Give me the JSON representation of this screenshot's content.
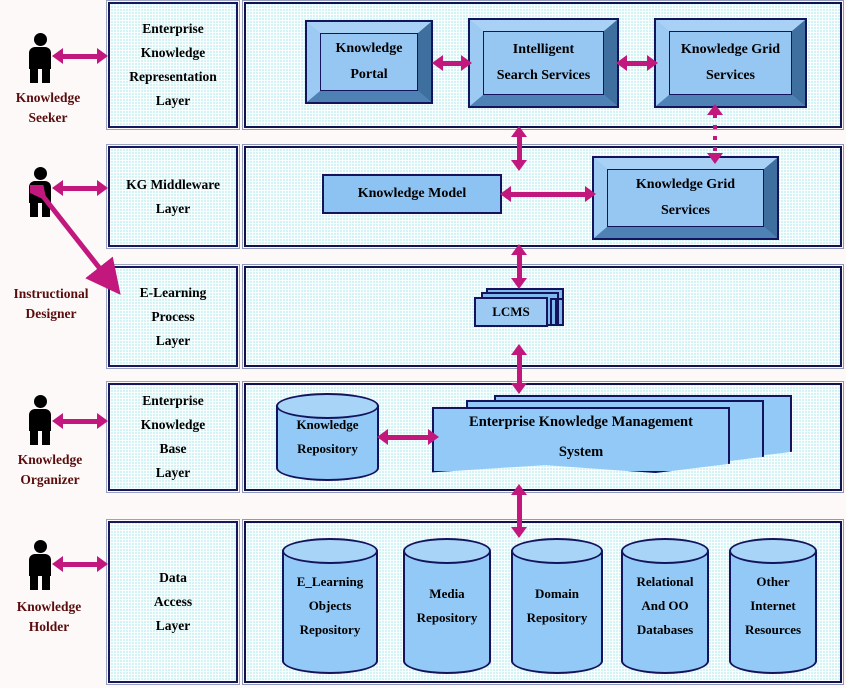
{
  "diagram": {
    "title": "Enterprise Knowledge Management Layered Architecture",
    "colors": {
      "arrow": "#c2187e",
      "box_border": "#14145c",
      "box_fill": "#93c9f6",
      "panel_fill": "#d3f3f5",
      "actor": "#000000",
      "actor_label": "#5a0d0d"
    }
  },
  "actors": [
    {
      "id": "knowledge-seeker",
      "label_line1": "Knowledge",
      "label_line2": "Seeker"
    },
    {
      "id": "instructional-designer",
      "label_line1": "Instructional",
      "label_line2": "Designer"
    },
    {
      "id": "knowledge-organizer",
      "label_line1": "Knowledge",
      "label_line2": "Organizer"
    },
    {
      "id": "knowledge-holder",
      "label_line1": "Knowledge",
      "label_line2": "Holder"
    }
  ],
  "layers": [
    {
      "id": "enterprise-knowledge-representation-layer",
      "label": "Enterprise\nKnowledge\nRepresentation\nLayer",
      "nodes": [
        {
          "id": "knowledge-portal",
          "label": "Knowledge\nPortal",
          "shape": "bevel-box"
        },
        {
          "id": "intelligent-search-services",
          "label": "Intelligent\nSearch Services",
          "shape": "bevel-box"
        },
        {
          "id": "knowledge-grid-services-top",
          "label": "Knowledge Grid\nServices",
          "shape": "bevel-box"
        }
      ]
    },
    {
      "id": "kg-middleware-layer",
      "label": "KG Middleware\nLayer",
      "nodes": [
        {
          "id": "knowledge-model",
          "label": "Knowledge Model",
          "shape": "flat-box"
        },
        {
          "id": "knowledge-grid-services-middle",
          "label": "Knowledge Grid\nServices",
          "shape": "bevel-box"
        }
      ]
    },
    {
      "id": "e-learning-process-layer",
      "label": "E-Learning\nProcess\nLayer",
      "nodes": [
        {
          "id": "lcms",
          "label": "LCMS",
          "shape": "stacked-box"
        }
      ]
    },
    {
      "id": "enterprise-knowledge-base-layer",
      "label": "Enterprise\nKnowledge\nBase\nLayer",
      "nodes": [
        {
          "id": "knowledge-repository",
          "label": "Knowledge\nRepository",
          "shape": "cylinder"
        },
        {
          "id": "enterprise-knowledge-management-system",
          "label": "Enterprise Knowledge Management\nSystem",
          "shape": "stacked-document"
        }
      ]
    },
    {
      "id": "data-access-layer",
      "label": "Data\nAccess\nLayer",
      "nodes": [
        {
          "id": "e-learning-objects-repository",
          "label": "E_Learning\nObjects\nRepository",
          "shape": "cylinder"
        },
        {
          "id": "media-repository",
          "label": "Media\nRepository",
          "shape": "cylinder"
        },
        {
          "id": "domain-repository",
          "label": "Domain\nRepository",
          "shape": "cylinder"
        },
        {
          "id": "relational-and-oo-databases",
          "label": "Relational\nAnd OO\nDatabases",
          "shape": "cylinder"
        },
        {
          "id": "other-internet-resources",
          "label": "Other\nInternet\nResources",
          "shape": "cylinder"
        }
      ]
    }
  ],
  "labels": {
    "layer1_l1": "Enterprise",
    "layer1_l2": "Knowledge",
    "layer1_l3": "Representation",
    "layer1_l4": "Layer",
    "layer2_l1": "KG Middleware",
    "layer2_l2": "Layer",
    "layer3_l1": "E-Learning",
    "layer3_l2": "Process",
    "layer3_l3": "Layer",
    "layer4_l1": "Enterprise",
    "layer4_l2": "Knowledge",
    "layer4_l3": "Base",
    "layer4_l4": "Layer",
    "layer5_l1": "Data",
    "layer5_l2": "Access",
    "layer5_l3": "Layer",
    "knowledge_portal_l1": "Knowledge",
    "knowledge_portal_l2": "Portal",
    "intelligent_search_l1": "Intelligent",
    "intelligent_search_l2": "Search Services",
    "kg_services_top_l1": "Knowledge Grid",
    "kg_services_top_l2": "Services",
    "knowledge_model": "Knowledge Model",
    "kg_services_mid_l1": "Knowledge Grid",
    "kg_services_mid_l2": "Services",
    "lcms": "LCMS",
    "knowledge_repo_l1": "Knowledge",
    "knowledge_repo_l2": "Repository",
    "ekms_l1": "Enterprise Knowledge Management",
    "ekms_l2": "System",
    "elo_l1": "E_Learning",
    "elo_l2": "Objects",
    "elo_l3": "Repository",
    "media_l1": "Media",
    "media_l2": "Repository",
    "domain_l1": "Domain",
    "domain_l2": "Repository",
    "rdb_l1": "Relational",
    "rdb_l2": "And OO",
    "rdb_l3": "Databases",
    "oir_l1": "Other",
    "oir_l2": "Internet",
    "oir_l3": "Resources",
    "actor1_l1": "Knowledge",
    "actor1_l2": "Seeker",
    "actor2_l1": "Instructional",
    "actor2_l2": "Designer",
    "actor3_l1": "Knowledge",
    "actor3_l2": "Organizer",
    "actor4_l1": "Knowledge",
    "actor4_l2": "Holder"
  },
  "connections": [
    {
      "id": "seeker-to-layer1",
      "from": "knowledge-seeker",
      "to": "enterprise-knowledge-representation-layer",
      "style": "solid-double-horizontal"
    },
    {
      "id": "designer-to-layer2",
      "from": "instructional-designer",
      "to": "kg-middleware-layer",
      "style": "solid-double-horizontal"
    },
    {
      "id": "designer-to-layer3",
      "from": "instructional-designer",
      "to": "e-learning-process-layer",
      "style": "solid-double-diagonal"
    },
    {
      "id": "organizer-to-layer4",
      "from": "knowledge-organizer",
      "to": "enterprise-knowledge-base-layer",
      "style": "solid-double-horizontal"
    },
    {
      "id": "holder-to-layer5",
      "from": "knowledge-holder",
      "to": "data-access-layer",
      "style": "solid-double-horizontal"
    },
    {
      "id": "portal-to-search",
      "from": "knowledge-portal",
      "to": "intelligent-search-services",
      "style": "solid-double-horizontal"
    },
    {
      "id": "search-to-grid",
      "from": "intelligent-search-services",
      "to": "knowledge-grid-services-top",
      "style": "solid-double-horizontal"
    },
    {
      "id": "search-to-model",
      "from": "intelligent-search-services",
      "to": "knowledge-model",
      "style": "solid-double-vertical"
    },
    {
      "id": "gridtop-to-gridmid",
      "from": "knowledge-grid-services-top",
      "to": "knowledge-grid-services-middle",
      "style": "dotted-double-vertical"
    },
    {
      "id": "model-to-gridmid",
      "from": "knowledge-model",
      "to": "knowledge-grid-services-middle",
      "style": "solid-double-horizontal"
    },
    {
      "id": "layer2-to-layer3",
      "from": "kg-middleware-layer",
      "to": "e-learning-process-layer",
      "style": "solid-double-vertical"
    },
    {
      "id": "layer3-to-layer4",
      "from": "e-learning-process-layer",
      "to": "enterprise-knowledge-base-layer",
      "style": "solid-double-vertical"
    },
    {
      "id": "repo-to-ekms",
      "from": "knowledge-repository",
      "to": "enterprise-knowledge-management-system",
      "style": "solid-double-horizontal"
    },
    {
      "id": "layer4-to-layer5",
      "from": "enterprise-knowledge-base-layer",
      "to": "data-access-layer",
      "style": "solid-double-vertical"
    }
  ]
}
